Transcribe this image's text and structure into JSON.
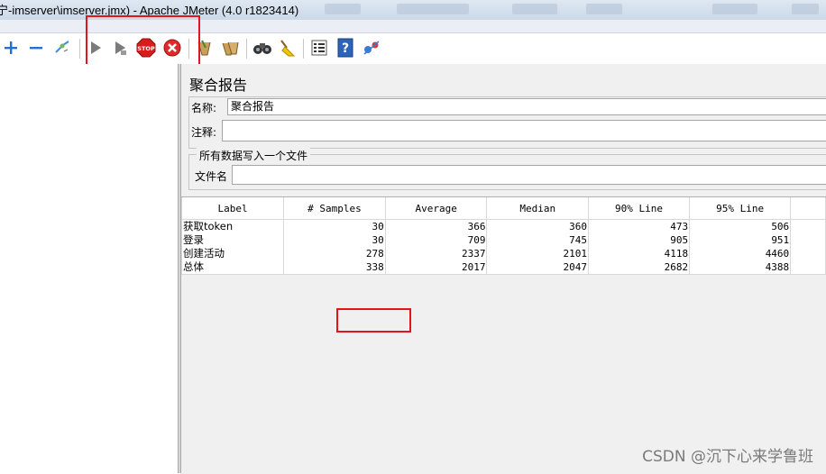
{
  "window": {
    "title": "宁-imserver\\imserver.jmx) - Apache JMeter (4.0 r1823414)"
  },
  "toolbar": {
    "icons": [
      "plus-icon",
      "minus-icon",
      "toggle-icon",
      "start-icon",
      "start-no-pause-icon",
      "stop-icon",
      "shutdown-icon",
      "clear-icon",
      "clear-all-icon",
      "search-icon",
      "reset-search-icon",
      "function-helper-icon",
      "help-icon",
      "remote-icon"
    ],
    "colors": {
      "start": "#7b7b7b",
      "stop": "#d71c1c",
      "plus": "#2a6fd0",
      "highlight": "#e0151e"
    }
  },
  "panel": {
    "title": "聚合报告",
    "name_label": "名称:",
    "name_value": "聚合报告",
    "comment_label": "注释:",
    "comment_value": "",
    "file_group_title": "所有数据写入一个文件",
    "filename_label": "文件名",
    "filename_value": ""
  },
  "table": {
    "columns": [
      "Label",
      "# Samples",
      "Average",
      "Median",
      "90% Line",
      "95% Line"
    ],
    "rows": [
      {
        "label": "获取token",
        "samples": "30",
        "average": "366",
        "median": "360",
        "line90": "473",
        "line95": "506"
      },
      {
        "label": "登录",
        "samples": "30",
        "average": "709",
        "median": "745",
        "line90": "905",
        "line95": "951"
      },
      {
        "label": "创建活动",
        "samples": "278",
        "average": "2337",
        "median": "2101",
        "line90": "4118",
        "line95": "4460"
      },
      {
        "label": "总体",
        "samples": "338",
        "average": "2017",
        "median": "2047",
        "line90": "2682",
        "line95": "4388"
      }
    ]
  },
  "watermark": "CSDN @沉下心来学鲁班"
}
